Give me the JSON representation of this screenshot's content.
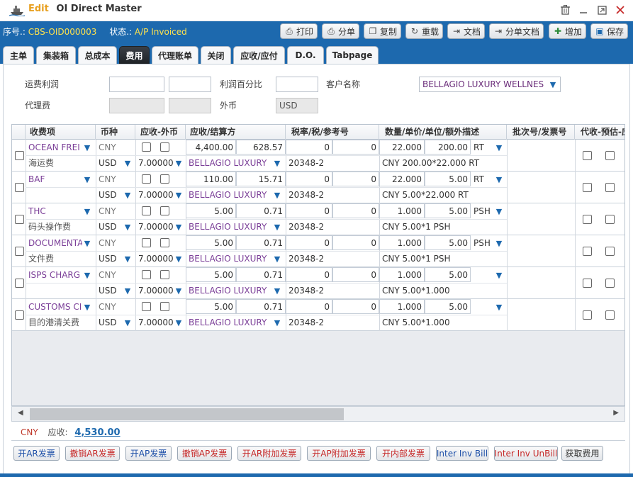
{
  "window": {
    "edit_label": "Edit",
    "title": "OI Direct Master"
  },
  "toolbar": {
    "seq_label": "序号.:",
    "seq_value": "CBS-OID000003",
    "status_label": "状态.:",
    "status_value": "A/P Invoiced",
    "buttons": [
      "打印",
      "分单",
      "复制",
      "重载",
      "文档",
      "分单文档",
      "增加",
      "保存"
    ]
  },
  "tabs": [
    "主单",
    "集装箱",
    "总成本",
    "费用",
    "代理账单",
    "关闭",
    "应收/应付",
    "D.O.",
    "Tabpage"
  ],
  "active_tab": "费用",
  "form": {
    "freight_profit_label": "运费利润",
    "profit_pct_label": "利润百分比",
    "customer_label": "客户名称",
    "customer_value": "BELLAGIO LUXURY WELLNES",
    "agent_fee_label": "代理费",
    "foreign_currency_label": "外币",
    "foreign_currency_value": "USD"
  },
  "grid": {
    "headers": [
      "收费项",
      "币种",
      "应收-外币",
      "应收/结算方",
      "税率/税/参考号",
      "数量/单价/单位/额外描述",
      "批次号/发票号",
      "代收-预估-应"
    ],
    "rows": [
      {
        "charge": "OCEAN FREI",
        "charge_cn": "海运费",
        "cur": "CNY",
        "cur2": "USD",
        "rate": "7.00000",
        "amount": "4,400.00",
        "foreign": "628.57",
        "party": "BELLAGIO LUXURY",
        "tax_rate": "0",
        "tax": "0",
        "ref": "20348-2",
        "qty": "22.000",
        "price": "200.00",
        "unit": "RT",
        "desc": "CNY 200.00*22.000 RT"
      },
      {
        "charge": "BAF",
        "charge_cn": "",
        "cur": "CNY",
        "cur2": "USD",
        "rate": "7.00000",
        "amount": "110.00",
        "foreign": "15.71",
        "party": "BELLAGIO LUXURY",
        "tax_rate": "0",
        "tax": "0",
        "ref": "20348-2",
        "qty": "22.000",
        "price": "5.00",
        "unit": "RT",
        "desc": "CNY 5.00*22.000 RT"
      },
      {
        "charge": "THC",
        "charge_cn": "码头操作费",
        "cur": "CNY",
        "cur2": "USD",
        "rate": "7.00000",
        "amount": "5.00",
        "foreign": "0.71",
        "party": "BELLAGIO LUXURY",
        "tax_rate": "0",
        "tax": "0",
        "ref": "20348-2",
        "qty": "1.000",
        "price": "5.00",
        "unit": "PSH",
        "desc": "CNY 5.00*1 PSH"
      },
      {
        "charge": "DOCUMENTA",
        "charge_cn": "文件费",
        "cur": "CNY",
        "cur2": "USD",
        "rate": "7.00000",
        "amount": "5.00",
        "foreign": "0.71",
        "party": "BELLAGIO LUXURY",
        "tax_rate": "0",
        "tax": "0",
        "ref": "20348-2",
        "qty": "1.000",
        "price": "5.00",
        "unit": "PSH",
        "desc": "CNY 5.00*1 PSH"
      },
      {
        "charge": "ISPS CHARG",
        "charge_cn": "",
        "cur": "CNY",
        "cur2": "USD",
        "rate": "7.00000",
        "amount": "5.00",
        "foreign": "0.71",
        "party": "BELLAGIO LUXURY",
        "tax_rate": "0",
        "tax": "0",
        "ref": "20348-2",
        "qty": "1.000",
        "price": "5.00",
        "unit": "",
        "desc": "CNY 5.00*1.000"
      },
      {
        "charge": "CUSTOMS CI",
        "charge_cn": "目的港清关费",
        "cur": "CNY",
        "cur2": "USD",
        "rate": "7.00000",
        "amount": "5.00",
        "foreign": "0.71",
        "party": "BELLAGIO LUXURY",
        "tax_rate": "0",
        "tax": "0",
        "ref": "20348-2",
        "qty": "1.000",
        "price": "5.00",
        "unit": "",
        "desc": "CNY 5.00*1.000"
      }
    ]
  },
  "totals": {
    "currency": "CNY",
    "receivable_label": "应收:",
    "receivable_value": "4,530.00"
  },
  "bottom_buttons": [
    {
      "label": "开AR发票",
      "color": "blue"
    },
    {
      "label": "撤销AR发票",
      "color": "red"
    },
    {
      "label": "开AP发票",
      "color": "blue"
    },
    {
      "label": "撤销AP发票",
      "color": "red"
    },
    {
      "label": "开AR附加发票",
      "color": "red"
    },
    {
      "label": "开AP附加发票",
      "color": "red"
    },
    {
      "label": "开内部发票",
      "color": "red"
    },
    {
      "label": "Inter Inv Bill",
      "color": "blue"
    },
    {
      "label": "Inter Inv UnBill",
      "color": "red"
    },
    {
      "label": "获取费用",
      "color": "dark"
    }
  ],
  "colors": {
    "brand_blue": "#1d69ae",
    "edit_orange": "#e8a020",
    "status_yellow": "#ffe24d",
    "link_purple": "#7b3f98"
  },
  "icons": {
    "app": "ship-icon",
    "trash": "trash-icon",
    "minimize": "minimize-icon",
    "maximize": "maximize-icon",
    "close": "close-icon"
  }
}
